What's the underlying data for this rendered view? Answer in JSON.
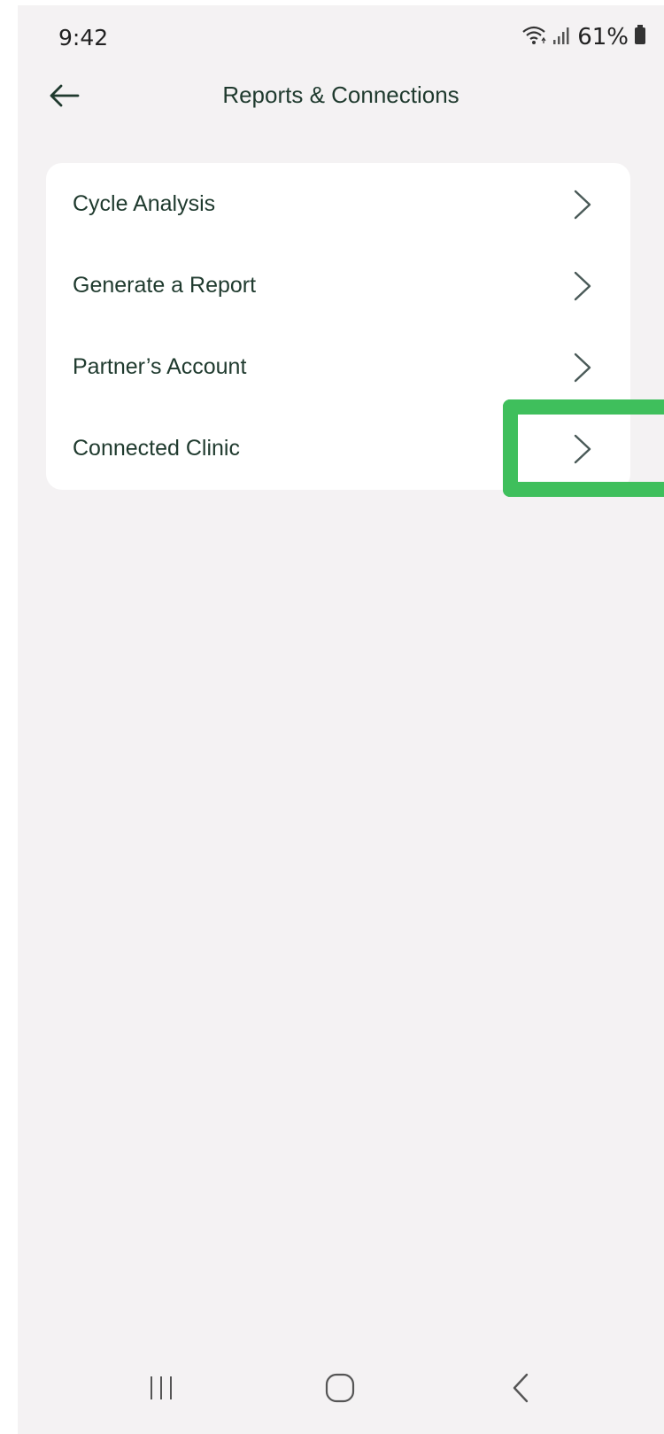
{
  "status_bar": {
    "time": "9:42",
    "battery": "61%",
    "icons": [
      "wifi-icon",
      "signal-icon",
      "battery-icon"
    ]
  },
  "header": {
    "title": "Reports & Connections",
    "back_icon": "arrow-left-icon"
  },
  "menu": {
    "items": [
      {
        "label": "Cycle Analysis",
        "icon": "chevron-right-icon"
      },
      {
        "label": "Generate a Report",
        "icon": "chevron-right-icon"
      },
      {
        "label": "Partner’s Account",
        "icon": "chevron-right-icon"
      },
      {
        "label": "Connected Clinic",
        "icon": "chevron-right-icon"
      }
    ]
  },
  "nav_bar": {
    "icons": [
      "recent-apps-icon",
      "home-icon",
      "back-icon"
    ]
  },
  "colors": {
    "background": "#f4f2f3",
    "card": "#ffffff",
    "text": "#1f3a2e",
    "highlight": "#3fbf5c"
  }
}
